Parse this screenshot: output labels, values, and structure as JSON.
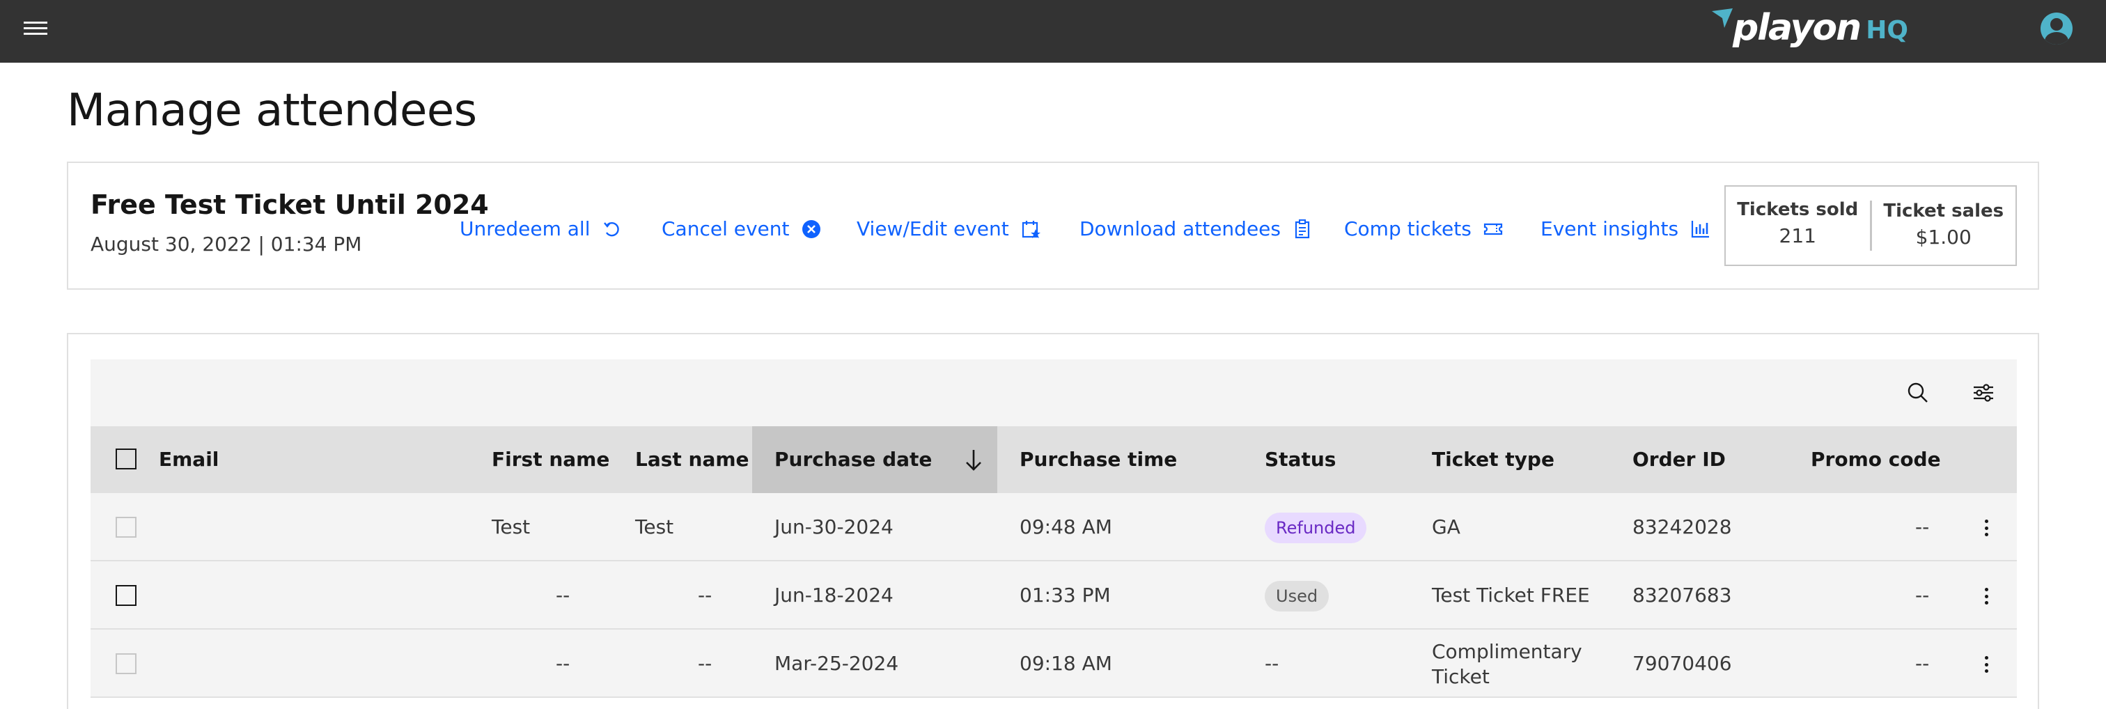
{
  "header": {
    "logo_text": "playon",
    "logo_suffix": "HQ"
  },
  "page": {
    "title": "Manage attendees"
  },
  "event": {
    "name": "Free Test Ticket Until 2024",
    "datetime": "August 30, 2022 | 01:34 PM",
    "actions": [
      {
        "label": "Unredeem all",
        "icon": "undo-icon"
      },
      {
        "label": "Cancel event",
        "icon": "close-circle-icon"
      },
      {
        "label": "View/Edit event",
        "icon": "calendar-star-icon"
      },
      {
        "label": "Download attendees",
        "icon": "clipboard-icon"
      },
      {
        "label": "Comp tickets",
        "icon": "ticket-icon"
      },
      {
        "label": "Event insights",
        "icon": "bar-chart-icon"
      }
    ],
    "stats": {
      "tickets_sold_label": "Tickets sold",
      "tickets_sold_value": "211",
      "ticket_sales_label": "Ticket sales",
      "ticket_sales_value": "$1.00"
    }
  },
  "table": {
    "columns": [
      "Email",
      "First name",
      "Last name",
      "Purchase date",
      "Purchase time",
      "Status",
      "Ticket type",
      "Order ID",
      "Promo code"
    ],
    "sorted_column": "Purchase date",
    "rows": [
      {
        "email": "",
        "first_name": "Test",
        "last_name": "Test",
        "purchase_date": "Jun-30-2024",
        "purchase_time": "09:48 AM",
        "status": "Refunded",
        "ticket_type": "GA",
        "order_id": "83242028",
        "promo_code": "--",
        "checkbox_enabled": false
      },
      {
        "email": "",
        "first_name": "--",
        "last_name": "--",
        "purchase_date": "Jun-18-2024",
        "purchase_time": "01:33 PM",
        "status": "Used",
        "ticket_type": "Test Ticket FREE",
        "order_id": "83207683",
        "promo_code": "--",
        "checkbox_enabled": true
      },
      {
        "email": "",
        "first_name": "--",
        "last_name": "--",
        "purchase_date": "Mar-25-2024",
        "purchase_time": "09:18 AM",
        "status": "--",
        "ticket_type": "Complimentary Ticket",
        "order_id": "79070406",
        "promo_code": "--",
        "checkbox_enabled": false
      }
    ]
  },
  "colors": {
    "topbar": "#333333",
    "accent": "#0f62fe",
    "brand_teal": "#4fb3c9",
    "refunded_bg": "#e8daff",
    "refunded_fg": "#6929c4",
    "used_bg": "#e0e0e0",
    "used_fg": "#525252"
  }
}
